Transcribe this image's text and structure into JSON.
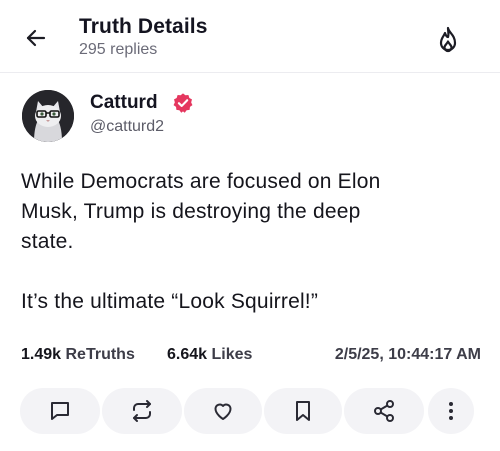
{
  "header": {
    "title": "Truth Details",
    "replies": "295 replies"
  },
  "author": {
    "name": "Catturd",
    "handle": "@catturd2",
    "verified": true
  },
  "post": {
    "text": "While Democrats are focused on Elon\nMusk, Trump is destroying the deep\nstate.\n\nIt’s the ultimate “Look Squirrel!”"
  },
  "stats": {
    "retruths_count": "1.49k",
    "retruths_label": "ReTruths",
    "likes_count": "6.64k",
    "likes_label": "Likes",
    "timestamp": "2/5/25, 10:44:17 AM"
  },
  "icons": {
    "back": "arrow-left-icon",
    "trending": "fire-icon",
    "verified": "verified-badge-icon",
    "reply": "message-square-icon",
    "retruth": "repeat-icon",
    "like": "heart-icon",
    "bookmark": "bookmark-icon",
    "share": "share-icon",
    "more": "more-vertical-icon"
  },
  "colors": {
    "verified": "#e5375f",
    "text": "#15151c",
    "muted": "#6b6b78",
    "action_bg": "#f3f3f6"
  }
}
